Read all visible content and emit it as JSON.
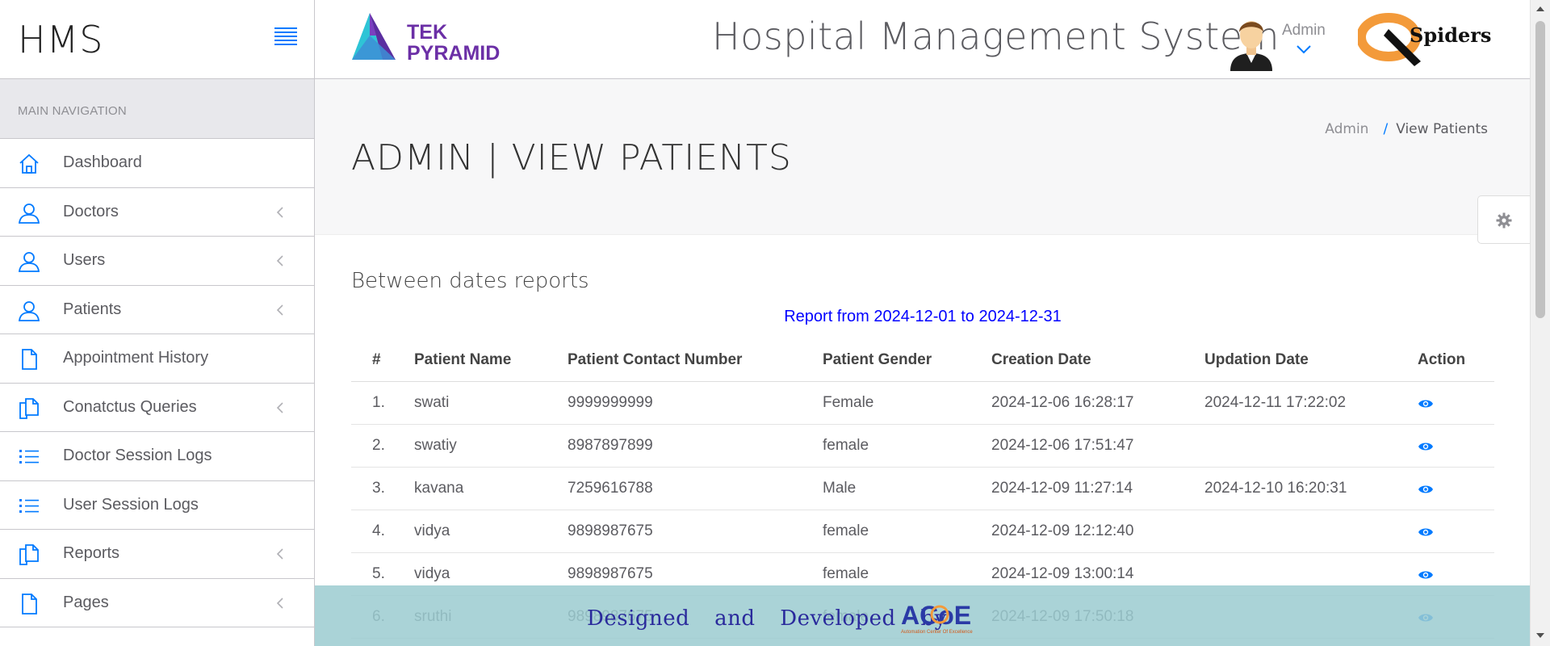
{
  "app": {
    "brand": "HMS",
    "header_title": "Hospital Management System",
    "tek_logo_text": [
      "TEK",
      "PYRAMID"
    ],
    "qspiders_logo_text": "Spiders",
    "user_name": "Admin"
  },
  "sidebar": {
    "nav_title": "MAIN NAVIGATION",
    "items": [
      {
        "label": "Dashboard",
        "icon": "home-icon",
        "has_submenu": false
      },
      {
        "label": "Doctors",
        "icon": "user-icon",
        "has_submenu": true
      },
      {
        "label": "Users",
        "icon": "user-icon",
        "has_submenu": true
      },
      {
        "label": "Patients",
        "icon": "user-icon",
        "has_submenu": true
      },
      {
        "label": "Appointment History",
        "icon": "file-icon",
        "has_submenu": false
      },
      {
        "label": "Conatctus Queries",
        "icon": "files-icon",
        "has_submenu": true
      },
      {
        "label": "Doctor Session Logs",
        "icon": "list-icon",
        "has_submenu": false
      },
      {
        "label": "User Session Logs",
        "icon": "list-icon",
        "has_submenu": false
      },
      {
        "label": "Reports",
        "icon": "files-icon",
        "has_submenu": true
      },
      {
        "label": "Pages",
        "icon": "file-icon",
        "has_submenu": true
      }
    ]
  },
  "page": {
    "title": "ADMIN | VIEW PATIENTS",
    "breadcrumb": [
      "Admin",
      "View Patients"
    ],
    "breadcrumb_separator": "/"
  },
  "report": {
    "section_title": "Between dates reports",
    "range_text": "Report from 2024-12-01 to 2024-12-31",
    "columns": [
      "#",
      "Patient Name",
      "Patient Contact Number",
      "Patient Gender",
      "Creation Date",
      "Updation Date",
      "Action"
    ],
    "rows": [
      {
        "num": "1.",
        "name": "swati",
        "contact": "9999999999",
        "gender": "Female",
        "created": "2024-12-06 16:28:17",
        "updated": "2024-12-11 17:22:02"
      },
      {
        "num": "2.",
        "name": "swatiy",
        "contact": "8987897899",
        "gender": "female",
        "created": "2024-12-06 17:51:47",
        "updated": ""
      },
      {
        "num": "3.",
        "name": "kavana",
        "contact": "7259616788",
        "gender": "Male",
        "created": "2024-12-09 11:27:14",
        "updated": "2024-12-10 16:20:31"
      },
      {
        "num": "4.",
        "name": "vidya",
        "contact": "9898987675",
        "gender": "female",
        "created": "2024-12-09 12:12:40",
        "updated": ""
      },
      {
        "num": "5.",
        "name": "vidya",
        "contact": "9898987675",
        "gender": "female",
        "created": "2024-12-09 13:00:14",
        "updated": ""
      },
      {
        "num": "6.",
        "name": "sruthi",
        "contact": "9898987675",
        "gender": "female",
        "created": "2024-12-09 17:50:18",
        "updated": ""
      }
    ],
    "action_icon": "eye-icon"
  },
  "footer": {
    "text": "Designed and Developed by",
    "logo_text": "ACoE",
    "logo_subtext": "Automation Center Of Excellence"
  },
  "colors": {
    "accent": "#007aff",
    "report_range": "#0000ff",
    "footer_bg": "#9bcbd0",
    "footer_text": "#2a2a9c",
    "tek_purple": "#6b2fa6",
    "qspiders_orange": "#f39a3a"
  }
}
